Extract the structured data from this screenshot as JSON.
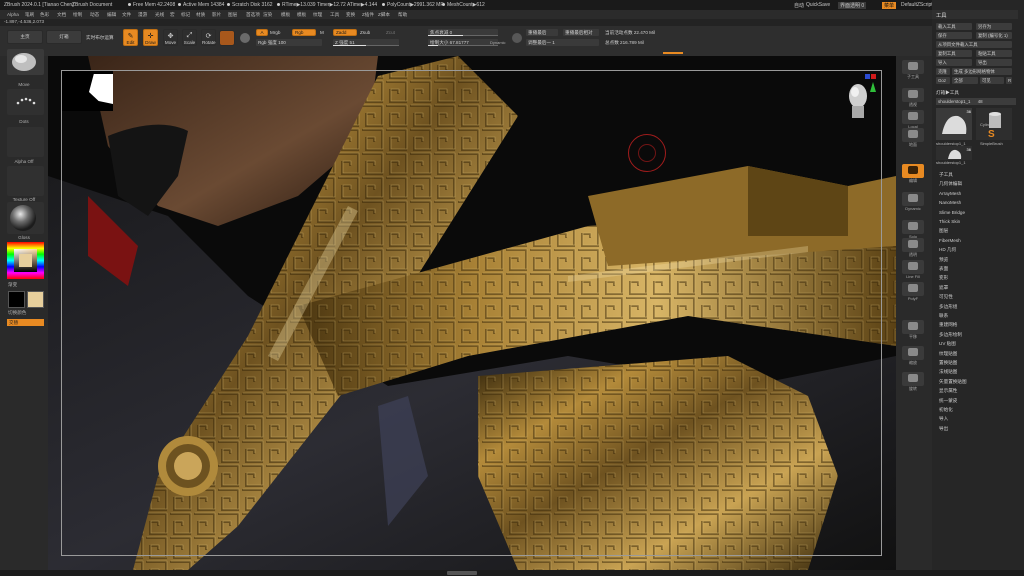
{
  "titlebar": {
    "app": "ZBrush 2024.0.1 [Tianao Chen]",
    "document": "ZBrush Document",
    "free_mem": "Free Mem 42.2408",
    "active_mem": "Active Mem 14384",
    "scratch": "Scratch Disk 3162",
    "rtime": "RTime▶13.039 Timer▶12.72 ATime▶4.144",
    "polycount": "PolyCount▶2991.362 MP",
    "meshcount": "MeshCount▶612",
    "autosave": "自动",
    "quicksave": "QuickSave",
    "transparency": "界面透明 0",
    "menu_btn": "菜单",
    "script": "DefaultZScript"
  },
  "menubar": [
    "Alpha",
    "笔刷",
    "色彩",
    "文档",
    "绘制",
    "动态",
    "编辑",
    "文件",
    "漫游",
    "光线",
    "宏",
    "标记",
    "材质",
    "影片",
    "图层",
    "首选项",
    "渲染",
    "模板",
    "模板",
    "纹理",
    "工具",
    "变换",
    "Z插件",
    "Z脚本",
    "帮助"
  ],
  "coords": "-1.897,-4.536,2.073",
  "shelf": {
    "lightbox": "主页",
    "quicksketch": "灯箱",
    "livebool": "实时布尔运算",
    "edit": "Edit",
    "draw": "Draw",
    "move": "Move",
    "scale": "Scale",
    "rotate": "Rotate",
    "a_btn": "A",
    "mrgb": "Mrgb",
    "rgb": "Rgb",
    "m": "M",
    "zadd": "Zadd",
    "zsub": "Zsub",
    "zcut": "Zcut",
    "rgb_intensity": "Rgb 强度 100",
    "z_intensity": "Z 强度 51",
    "focal_shift": "焦点衰减 0",
    "draw_size": "绘制大小 67.81777",
    "dynamic": "Dynamic",
    "replay_last": "重播最后",
    "replay_rel": "重播最后相对",
    "adjust_last": "调整最后一 1",
    "active_points": "当前活动点数 22.470 Mil",
    "total_points": "总点数 216.789 Mil"
  },
  "leftshelf": {
    "brush": "Move",
    "stroke": "Dots",
    "alpha": "Alpha Off",
    "texture": "Texture Off",
    "material": "Gloss",
    "gradient": "渐变",
    "switch": "切换颜色",
    "alternate": "交替"
  },
  "rightcol": [
    "子工具",
    "透视",
    "Local",
    "地面",
    "编辑",
    "Dynamic",
    "Solo",
    "透明",
    "Line Fill",
    "PolyF",
    "平移",
    "缩放",
    "旋转"
  ],
  "palette": {
    "title": "工具",
    "buttons": [
      "载入工具",
      "另存为",
      "保存",
      "复制 (编号化 1)",
      "从项目文件载入工具",
      "复制工具",
      "粘贴工具",
      "导入",
      "导出",
      "克隆",
      "生成 多边形网格物体",
      "Goz",
      "全部",
      "可见",
      "R"
    ],
    "lightbox_tools": "灯箱▶工具",
    "current_tool": "shoulderstop1_1",
    "current_tool_count": "48",
    "thumbs": [
      "shoulderstop1_1",
      "Cylinder3D",
      "shoulderstop1_1",
      "SimpleBrush"
    ],
    "thumb_badges": [
      "36",
      "36"
    ],
    "sections": [
      "子工具",
      "几何体编辑",
      "ArrayMesh",
      "NanoMesh",
      "Slime Bridge",
      "Thick Skin",
      "图层",
      "FiberMesh",
      "HD 几何",
      "预览",
      "表面",
      "变形",
      "遮罩",
      "可见性",
      "多边形组",
      "联系",
      "重建网格",
      "多边形绘制",
      "UV 贴图",
      "纹理贴图",
      "置换贴图",
      "法线贴图",
      "矢量置换贴图",
      "显示属性",
      "统一蒙皮",
      "初始化",
      "导入",
      "导出"
    ]
  },
  "colors": {
    "accent": "#e88a22",
    "gold": "#9a7a2e",
    "dark_bg": "#0a0a0a"
  }
}
